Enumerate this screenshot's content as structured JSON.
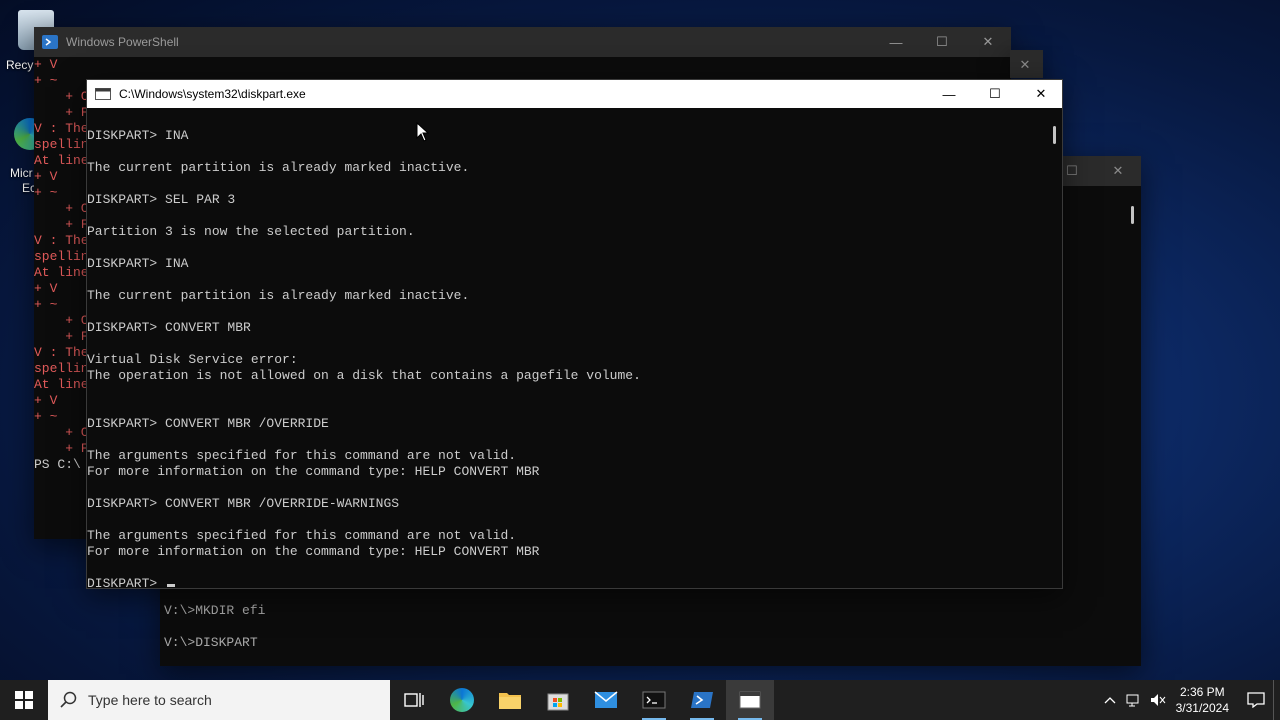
{
  "desktop": {
    "icons": [
      {
        "label": "Recy"
      },
      {
        "label": "Micr"
      },
      {
        "label": "Ec"
      }
    ]
  },
  "powershell_window": {
    "title": "Windows PowerShell",
    "controls": {
      "minimize": "—",
      "maximize": "☐",
      "close": "✕"
    },
    "lines": [
      "+ V",
      "+ ~",
      "    + C",
      "    + F",
      "V : The",
      "spellin",
      "At line",
      "+ V",
      "+ ~",
      "    + C",
      "    + F",
      "V : The",
      "spellin",
      "At line",
      "+ V",
      "+ ~",
      "    + C",
      "    + F",
      "V : The",
      "spellin",
      "At line",
      "+ V",
      "+ ~",
      "    + C",
      "    + F",
      "PS C:\\"
    ]
  },
  "cmd_window": {
    "lines": [
      "V:\\>MKDIR efi",
      "",
      "V:\\>DISKPART"
    ]
  },
  "diskpart_window": {
    "title": "C:\\Windows\\system32\\diskpart.exe",
    "controls": {
      "minimize": "—",
      "maximize": "☐",
      "close": "✕"
    },
    "lines": [
      "DISKPART> INA",
      "",
      "The current partition is already marked inactive.",
      "",
      "DISKPART> SEL PAR 3",
      "",
      "Partition 3 is now the selected partition.",
      "",
      "DISKPART> INA",
      "",
      "The current partition is already marked inactive.",
      "",
      "DISKPART> CONVERT MBR",
      "",
      "Virtual Disk Service error:",
      "The operation is not allowed on a disk that contains a pagefile volume.",
      "",
      "",
      "DISKPART> CONVERT MBR /OVERRIDE",
      "",
      "The arguments specified for this command are not valid.",
      "For more information on the command type: HELP CONVERT MBR",
      "",
      "DISKPART> CONVERT MBR /OVERRIDE-WARNINGS",
      "",
      "The arguments specified for this command are not valid.",
      "For more information on the command type: HELP CONVERT MBR",
      "",
      "DISKPART> "
    ]
  },
  "taskbar": {
    "search_placeholder": "Type here to search",
    "apps": [
      "task-view",
      "edge",
      "file-explorer",
      "store",
      "mail",
      "terminal",
      "powershell",
      "diskpart"
    ],
    "time": "2:36 PM",
    "date": "3/31/2024"
  },
  "colors": {
    "ps_error": "#e05a5a",
    "console_text": "#cccccc",
    "taskbar": "#1f1f1f",
    "accent": "#76b9ed"
  }
}
